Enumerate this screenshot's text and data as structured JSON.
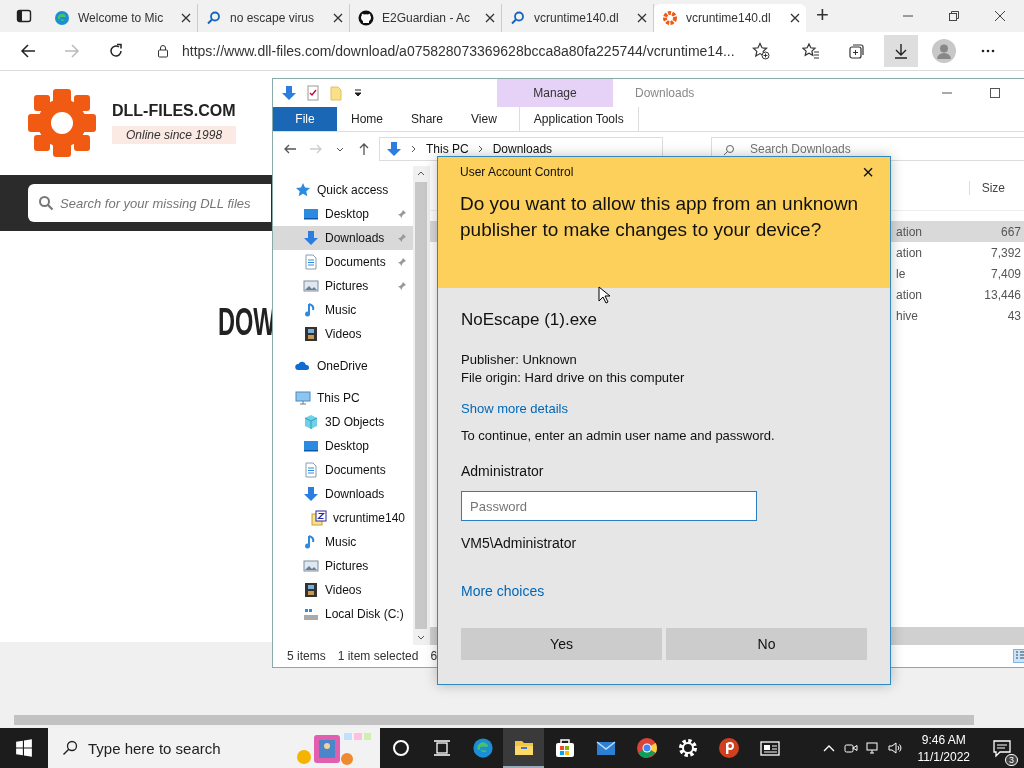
{
  "browser": {
    "tabs": [
      {
        "title": "Welcome to Mic",
        "kind": "edge",
        "selected": false
      },
      {
        "title": "no escape virus",
        "kind": "search",
        "selected": false
      },
      {
        "title": "E2Guardian - Ac",
        "kind": "github",
        "selected": false
      },
      {
        "title": "vcruntime140.dl",
        "kind": "search",
        "selected": false
      },
      {
        "title": "vcruntime140.dl",
        "kind": "gear",
        "selected": true
      }
    ],
    "new_tab": "+",
    "address": "https://www.dll-files.com/download/a075828073369628bcca8a80fa225744/vcruntime14..."
  },
  "website": {
    "logo": "DLL-FILES.COM",
    "tagline": "Online since 1998",
    "search_placeholder": "Search for your missing DLL files",
    "heading": "DOW"
  },
  "explorer": {
    "title": "Downloads",
    "context_group": "Manage",
    "ribbon_tabs": [
      {
        "label": "File",
        "selected": true
      },
      {
        "label": "Home",
        "selected": false
      },
      {
        "label": "Share",
        "selected": false
      },
      {
        "label": "View",
        "selected": false
      },
      {
        "label": "Application Tools",
        "selected": false
      }
    ],
    "breadcrumb": [
      "This PC",
      "Downloads"
    ],
    "search_placeholder": "Search Downloads",
    "nav": [
      {
        "label": "Quick access",
        "kind": "star",
        "selected": false,
        "pinned": false,
        "children": [
          {
            "label": "Desktop",
            "kind": "desktop",
            "selected": false,
            "pinned": true
          },
          {
            "label": "Downloads",
            "kind": "download",
            "selected": true,
            "pinned": true
          },
          {
            "label": "Documents",
            "kind": "document",
            "selected": false,
            "pinned": true
          },
          {
            "label": "Pictures",
            "kind": "pictures",
            "selected": false,
            "pinned": true
          },
          {
            "label": "Music",
            "kind": "music",
            "selected": false,
            "pinned": false
          },
          {
            "label": "Videos",
            "kind": "videos",
            "selected": false,
            "pinned": false
          }
        ]
      },
      {
        "label": "OneDrive",
        "kind": "cloud",
        "selected": false,
        "pinned": false
      },
      {
        "label": "This PC",
        "kind": "pc",
        "selected": false,
        "pinned": false,
        "children": [
          {
            "label": "3D Objects",
            "kind": "cube",
            "selected": false,
            "pinned": false
          },
          {
            "label": "Desktop",
            "kind": "desktop",
            "selected": false,
            "pinned": false
          },
          {
            "label": "Documents",
            "kind": "document",
            "selected": false,
            "pinned": false
          },
          {
            "label": "Downloads",
            "kind": "download",
            "selected": false,
            "pinned": false,
            "children": [
              {
                "label": "vcruntime140",
                "kind": "zip",
                "selected": false,
                "pinned": false
              }
            ]
          },
          {
            "label": "Music",
            "kind": "music",
            "selected": false,
            "pinned": false
          },
          {
            "label": "Pictures",
            "kind": "pictures",
            "selected": false,
            "pinned": false
          },
          {
            "label": "Videos",
            "kind": "videos",
            "selected": false,
            "pinned": false
          },
          {
            "label": "Local Disk (C:)",
            "kind": "disk",
            "selected": false,
            "pinned": false
          }
        ]
      }
    ],
    "columns": [
      "Size"
    ],
    "rows": [
      {
        "type": "ation",
        "size": "667",
        "selected": true
      },
      {
        "type": "ation",
        "size": "7,392",
        "selected": false
      },
      {
        "type": "le",
        "size": "7,409",
        "selected": false
      },
      {
        "type": "ation",
        "size": "13,446",
        "selected": false
      },
      {
        "type": "hive",
        "size": "43",
        "selected": false
      }
    ],
    "status": {
      "count": "5 items",
      "selection": "1 item selected",
      "size": "6"
    }
  },
  "uac": {
    "title": "User Account Control",
    "close": "×",
    "question": "Do you want to allow this app from an unknown publisher to make changes to your device?",
    "app": "NoEscape (1).exe",
    "publisher": "Publisher: Unknown",
    "origin": "File origin: Hard drive on this computer",
    "details_link": "Show more details",
    "instructions": "To continue, enter an admin user name and password.",
    "user": "Administrator",
    "password_placeholder": "Password",
    "domain_user": "VM5\\Administrator",
    "more_choices": "More choices",
    "buttons": [
      "Yes",
      "No"
    ]
  },
  "taskbar": {
    "search_placeholder": "Type here to search",
    "apps": [
      {
        "kind": "cortana",
        "active": false
      },
      {
        "kind": "taskview",
        "active": false
      },
      {
        "kind": "edge",
        "active": false
      },
      {
        "kind": "folder",
        "active": true
      },
      {
        "kind": "store",
        "active": false
      },
      {
        "kind": "mail",
        "active": false
      },
      {
        "kind": "chrome",
        "active": false
      },
      {
        "kind": "gear",
        "active": false
      },
      {
        "kind": "p-app",
        "active": false
      },
      {
        "kind": "news",
        "active": false
      }
    ],
    "time": "9:46 AM",
    "date": "11/1/2022",
    "notifications": "3"
  }
}
